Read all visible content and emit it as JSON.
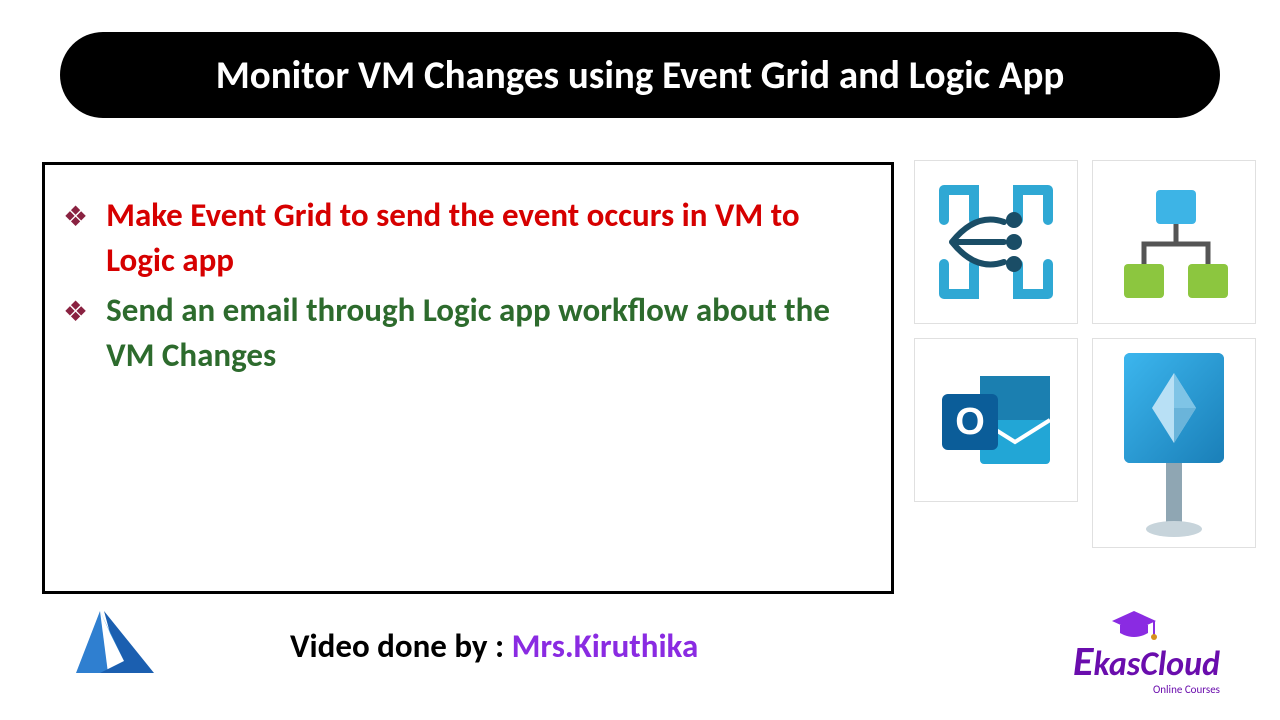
{
  "title": "Monitor VM Changes using Event Grid and Logic App",
  "bullets": [
    {
      "text": "Make Event Grid to send the event occurs in VM to Logic app",
      "color": "red"
    },
    {
      "text": "Send an email through Logic app workflow about the VM Changes",
      "color": "green"
    }
  ],
  "icons": {
    "event_grid": "event-grid-icon",
    "logic_app": "logic-app-icon",
    "outlook": "outlook-icon",
    "resource": "azure-resource-icon"
  },
  "footer": {
    "credit_label": "Video done by : ",
    "credit_name": "Mrs.Kiruthika"
  },
  "brand": {
    "azure": "azure-icon",
    "ekas_name": "kasCloud",
    "ekas_prefix": "E",
    "ekas_tag": "Online Courses"
  }
}
